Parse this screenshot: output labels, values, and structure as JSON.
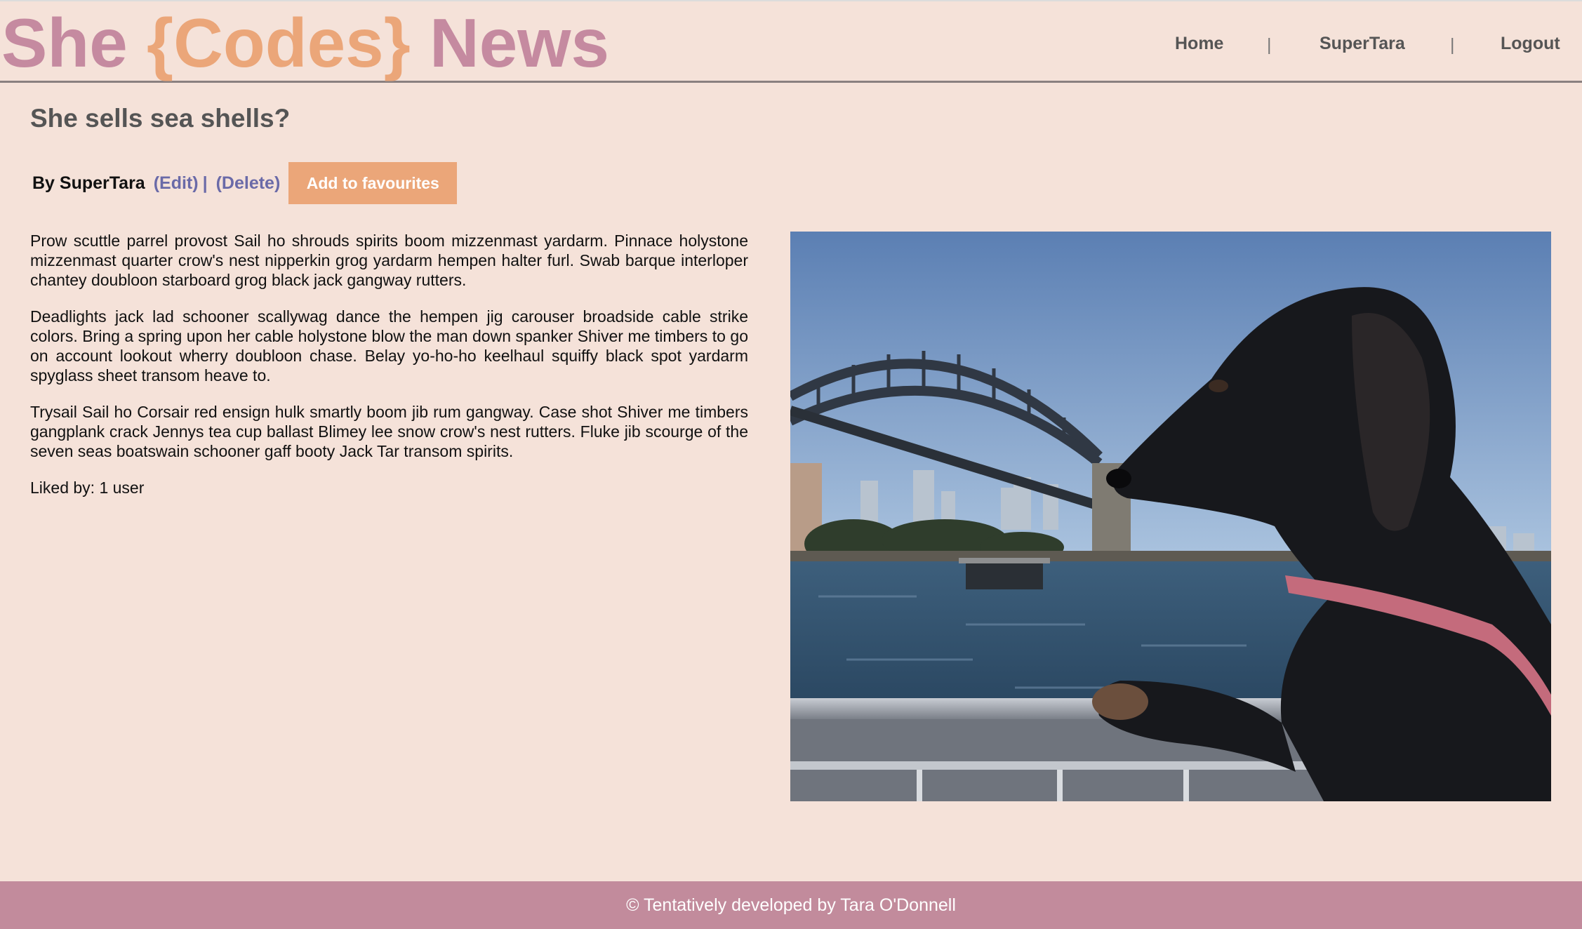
{
  "brand": {
    "part1": "She ",
    "part2": "{Codes}",
    "part3": " News"
  },
  "nav": {
    "home": "Home",
    "user": "SuperTara",
    "logout": "Logout",
    "separator": "|"
  },
  "article": {
    "title": "She sells sea shells?",
    "author": "By SuperTara",
    "edit_label": "(Edit)",
    "pipe": "|",
    "delete_label": "(Delete)",
    "favourite_label": "Add to favourites",
    "paragraphs": [
      "Prow scuttle parrel provost Sail ho shrouds spirits boom mizzenmast yardarm. Pinnace holystone mizzenmast quarter crow's nest nipperkin grog yardarm hempen halter furl. Swab barque interloper chantey doubloon starboard grog black jack gangway rutters.",
      "Deadlights jack lad schooner scallywag dance the hempen jig carouser broadside cable strike colors. Bring a spring upon her cable holystone blow the man down spanker Shiver me timbers to go on account lookout wherry doubloon chase. Belay yo-ho-ho keelhaul squiffy black spot yardarm spyglass sheet transom heave to.",
      "Trysail Sail ho Corsair red ensign hulk smartly boom jib rum gangway. Case shot Shiver me timbers gangplank crack Jennys tea cup ballast Blimey lee snow crow's nest rutters. Fluke jib scourge of the seven seas boatswain schooner gaff booty Jack Tar transom spirits."
    ],
    "likes": "Liked by: 1 user"
  },
  "footer": {
    "text": "© Tentatively developed by Tara O'Donnell"
  },
  "colors": {
    "background": "#f5e2d9",
    "brand_pink": "#c58aa0",
    "brand_orange": "#eba679",
    "link": "#6a6aa8",
    "footer": "#c28b9c"
  },
  "icons": {
    "photo": "dog-harbour-bridge-photo"
  }
}
